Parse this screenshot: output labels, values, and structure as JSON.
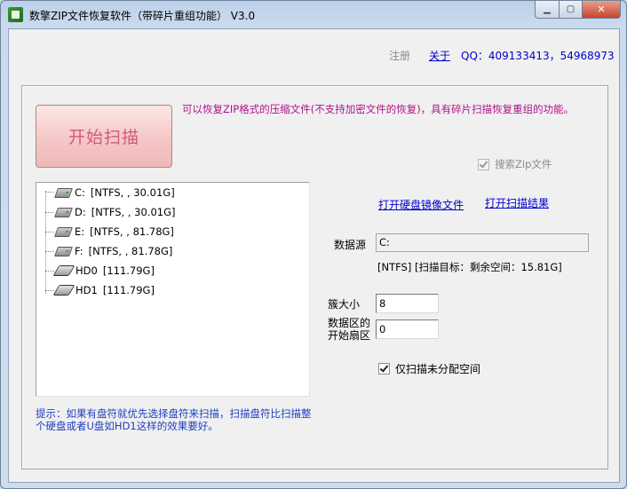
{
  "window": {
    "title": "数擎ZIP文件恢复软件（带碎片重组功能） V3.0",
    "buttons": {
      "minimize": "▁",
      "maximize": "▢",
      "close": "✕"
    }
  },
  "toplinks": {
    "register": "注册",
    "about": "关于",
    "qq": "QQ：409133413，54968973"
  },
  "scan": {
    "button_label": "开始扫描",
    "description": "可以恢复ZIP格式的压缩文件(不支持加密文件的恢复)，具有碎片扫描恢复重组的功能。",
    "search_zip_label": "搜索Zip文件",
    "search_zip_checked": true
  },
  "drives": [
    {
      "name": "C:",
      "info": "[NTFS, , 30.01G]",
      "icon": "drive-icon"
    },
    {
      "name": "D:",
      "info": "[NTFS, , 30.01G]",
      "icon": "drive-icon"
    },
    {
      "name": "E:",
      "info": "[NTFS, , 81.78G]",
      "icon": "drive-icon"
    },
    {
      "name": "F:",
      "info": "[NTFS, , 81.78G]",
      "icon": "drive-icon"
    },
    {
      "name": "HD0",
      "info": "[111.79G]",
      "icon": "disk-icon"
    },
    {
      "name": "HD1",
      "info": "[111.79G]",
      "icon": "disk-icon"
    }
  ],
  "links": {
    "open_image": "打开硬盘镜像文件",
    "open_result": "打开扫描结果"
  },
  "source": {
    "label": "数据源",
    "value": "C:",
    "info": "[NTFS]  [扫描目标：剩余空间：15.81G]"
  },
  "params": {
    "cluster_label": "簇大小",
    "cluster_value": "8",
    "start_label_line1": "数据区的",
    "start_label_line2": "开始扇区",
    "start_value": "0",
    "unalloc_label": "仅扫描未分配空间",
    "unalloc_checked": true
  },
  "hint": "提示：如果有盘符就优先选择盘符来扫描，扫描盘符比扫描整个硬盘或者U盘如HD1这样的效果要好。"
}
